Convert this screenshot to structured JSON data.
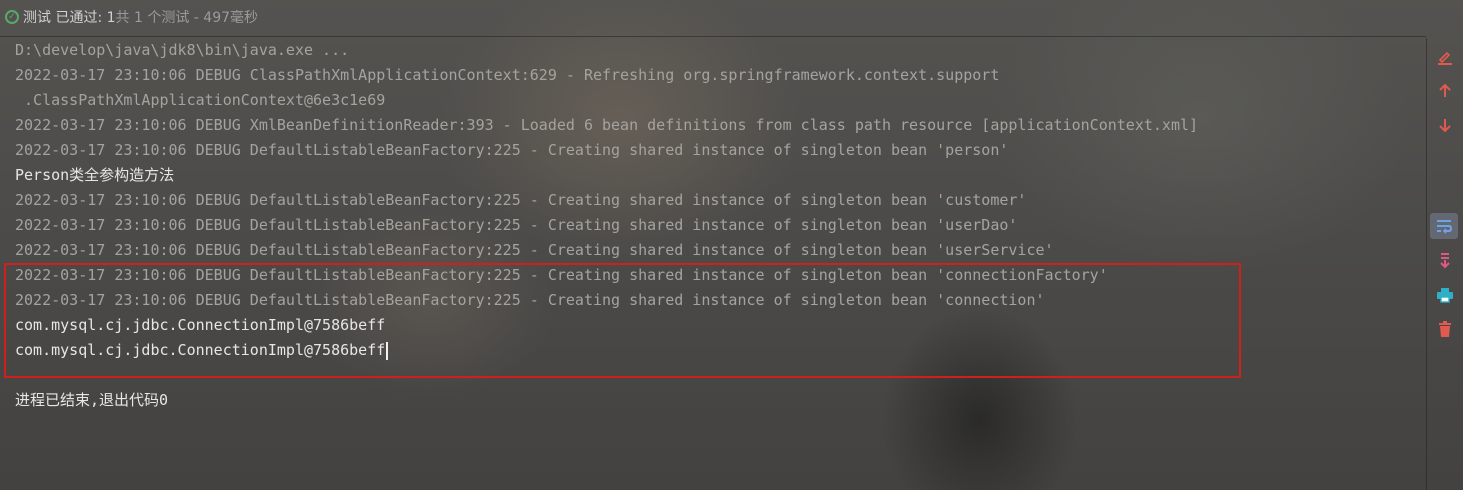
{
  "status": {
    "label": "测试 已通过: 1",
    "summary": "共 1 个测试 - 497毫秒",
    "colors": {
      "pass": "#59a869"
    }
  },
  "console": {
    "lines": [
      "D:\\develop\\java\\jdk8\\bin\\java.exe ...",
      "2022-03-17 23:10:06 DEBUG ClassPathXmlApplicationContext:629 - Refreshing org.springframework.context.support",
      " .ClassPathXmlApplicationContext@6e3c1e69",
      "2022-03-17 23:10:06 DEBUG XmlBeanDefinitionReader:393 - Loaded 6 bean definitions from class path resource [applicationContext.xml]",
      "2022-03-17 23:10:06 DEBUG DefaultListableBeanFactory:225 - Creating shared instance of singleton bean 'person'",
      "Person类全参构造方法",
      "2022-03-17 23:10:06 DEBUG DefaultListableBeanFactory:225 - Creating shared instance of singleton bean 'customer'",
      "2022-03-17 23:10:06 DEBUG DefaultListableBeanFactory:225 - Creating shared instance of singleton bean 'userDao'",
      "2022-03-17 23:10:06 DEBUG DefaultListableBeanFactory:225 - Creating shared instance of singleton bean 'userService'",
      "2022-03-17 23:10:06 DEBUG DefaultListableBeanFactory:225 - Creating shared instance of singleton bean 'connectionFactory'",
      "2022-03-17 23:10:06 DEBUG DefaultListableBeanFactory:225 - Creating shared instance of singleton bean 'connection'",
      "com.mysql.cj.jdbc.ConnectionImpl@7586beff",
      "com.mysql.cj.jdbc.ConnectionImpl@7586beff",
      "",
      "进程已结束,退出代码0"
    ],
    "colors": {
      "debug": "#a5a39f",
      "output": "#e6e6e6",
      "highlight_border": "#d0201c"
    }
  },
  "toolbar": {
    "items": [
      {
        "icon": "clear-edit-icon"
      },
      {
        "icon": "arrow-up-icon"
      },
      {
        "icon": "arrow-down-icon"
      },
      {
        "icon": "soft-wrap-icon"
      },
      {
        "icon": "scroll-to-end-icon"
      },
      {
        "icon": "print-icon"
      },
      {
        "icon": "trash-icon"
      }
    ]
  }
}
